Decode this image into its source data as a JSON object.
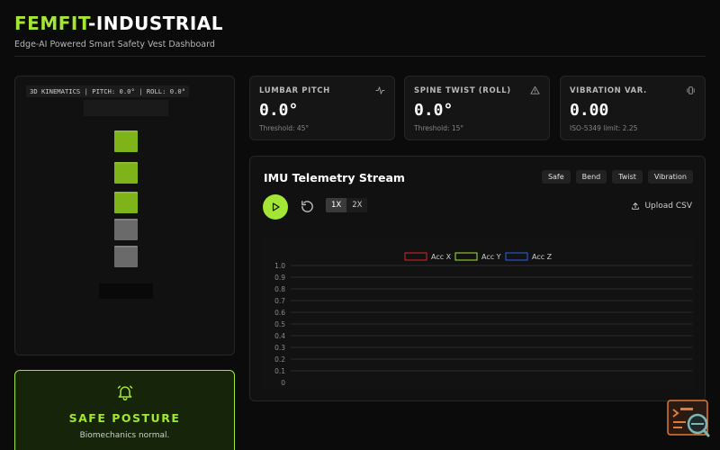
{
  "header": {
    "brand_accent": "FEMFIT",
    "brand_rest": "-INDUSTRIAL",
    "subtitle": "Edge-AI Powered Smart Safety Vest Dashboard"
  },
  "visualizer": {
    "label": "3D KINEMATICS | PITCH: 0.0° | ROLL: 0.0°"
  },
  "posture": {
    "icon": "bell-icon",
    "title": "SAFE POSTURE",
    "subtitle": "Biomechanics normal."
  },
  "metrics": [
    {
      "title": "LUMBAR PITCH",
      "icon": "activity-icon",
      "value": "0.0°",
      "note": "Threshold: 45°"
    },
    {
      "title": "SPINE TWIST (ROLL)",
      "icon": "warning-icon",
      "value": "0.0°",
      "note": "Threshold: 15°"
    },
    {
      "title": "VIBRATION VAR.",
      "icon": "vibration-icon",
      "value": "0.00",
      "note": "ISO-5349 limit: 2.25"
    }
  ],
  "telemetry": {
    "title": "IMU Telemetry Stream",
    "scenarios": [
      "Safe",
      "Bend",
      "Twist",
      "Vibration"
    ],
    "speeds": [
      "1X",
      "2X"
    ],
    "upload_label": "Upload CSV"
  },
  "colors": {
    "accent": "#a3e635",
    "acc_x": "#dc2626",
    "acc_y": "#a3e635",
    "acc_z": "#2563eb"
  },
  "chart_data": {
    "type": "line",
    "title": "",
    "xlabel": "",
    "ylabel": "",
    "ylim": [
      0,
      1
    ],
    "y_ticks": [
      "1.0",
      "0.9",
      "0.8",
      "0.7",
      "0.6",
      "0.5",
      "0.4",
      "0.3",
      "0.2",
      "0.1",
      "0"
    ],
    "grid": true,
    "legend_position": "top-center",
    "series": [
      {
        "name": "Acc X",
        "values": []
      },
      {
        "name": "Acc Y",
        "values": []
      },
      {
        "name": "Acc Z",
        "values": []
      }
    ]
  }
}
